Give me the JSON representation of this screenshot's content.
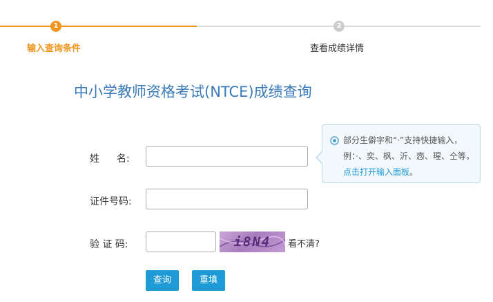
{
  "colors": {
    "accent": "#f0961e",
    "inactive_step": "#cccccc",
    "inactive_line": "#dddddd",
    "title": "#3a7ab8",
    "button": "#1e9ad6",
    "link": "#1e9ad6"
  },
  "steps": [
    {
      "number": "1",
      "label": "输入查询条件",
      "state": "active"
    },
    {
      "number": "2",
      "label": "查看成绩详情",
      "state": "inactive"
    }
  ],
  "title": "中小学教师资格考试(NTCE)成绩查询",
  "form": {
    "name_label_first": "姓",
    "name_label_second": "名:",
    "name_value": "",
    "id_label": "证件号码:",
    "id_value": "",
    "captcha_label": "验 证 码:",
    "captcha_value": "",
    "captcha_text": "i8N4",
    "captcha_refresh": "看不清?"
  },
  "buttons": {
    "query": "查询",
    "reset": "重填"
  },
  "tip": {
    "icon": "radio-dot-icon",
    "text": "部分生僻字和“·”支持快捷输入，例：·、奕、枫、沂、悫、瑆、仝等，",
    "link": "点击打开输入面板",
    "suffix": "。"
  }
}
